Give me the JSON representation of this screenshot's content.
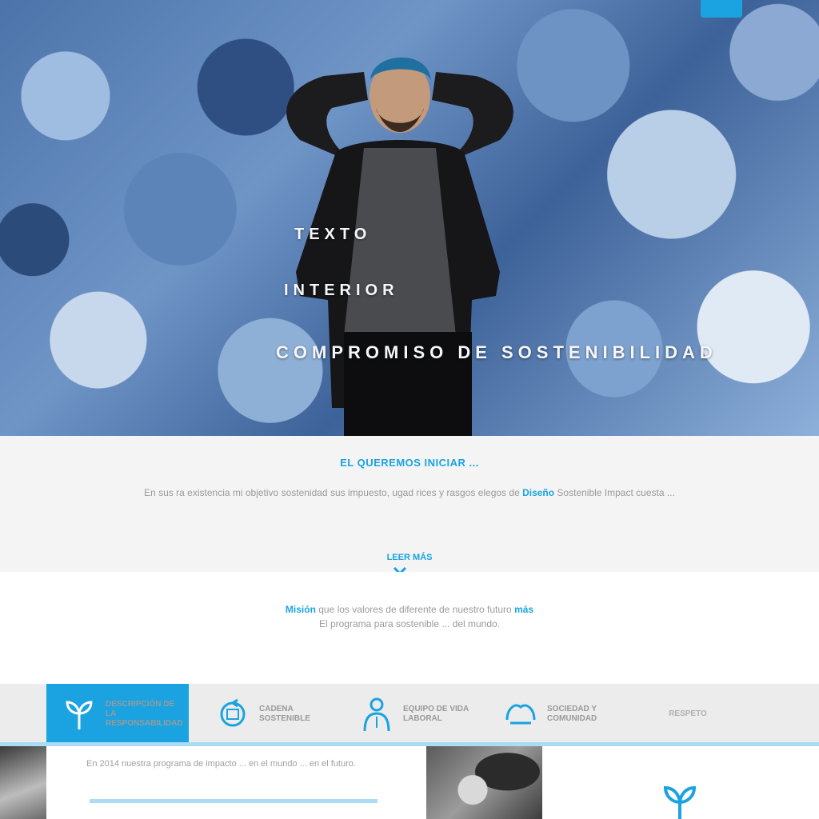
{
  "hero": {
    "line1": "TEXTO",
    "line2": "INTERIOR",
    "line3": "COMPROMISO DE SOSTENIBILIDAD"
  },
  "intro": {
    "title": "EL QUEREMOS INICIAR ...",
    "text_part1": "En sus ra existencia mi objetivo sostenidad sus impuesto, ugad rices y rasgos elegos de ",
    "text_highlight": "Diseño",
    "text_part2": " Sostenible Impact cuesta ...",
    "read_more": "LEER MÁS"
  },
  "mission": {
    "p1_highlight_a": "Misión",
    "p1_text": " que los valores de diferente de nuestro futuro ",
    "p1_highlight_b": "más",
    "p2_text": "El programa para sostenible ... del mundo."
  },
  "tabs": [
    {
      "label": "DESCRIPCIÓN DE LA RESPONSABILIDAD",
      "icon": "sprout-icon"
    },
    {
      "label": "CADENA SOSTENIBLE",
      "icon": "cycle-icon"
    },
    {
      "label": "EQUIPO DE VIDA LABORAL",
      "icon": "person-icon"
    },
    {
      "label": "SOCIEDAD Y COMUNIDAD",
      "icon": "hands-icon"
    },
    {
      "label": "RESPETO",
      "icon": ""
    }
  ],
  "content": {
    "text": "En 2014 nuestra programa de impacto ... en el mundo ... en el futuro."
  },
  "colors": {
    "accent": "#1aa3e0",
    "accent_light": "#aadcf3",
    "muted_text": "#9a9a9a",
    "intro_bg": "#f4f4f4",
    "tabs_bg": "#ececec"
  }
}
